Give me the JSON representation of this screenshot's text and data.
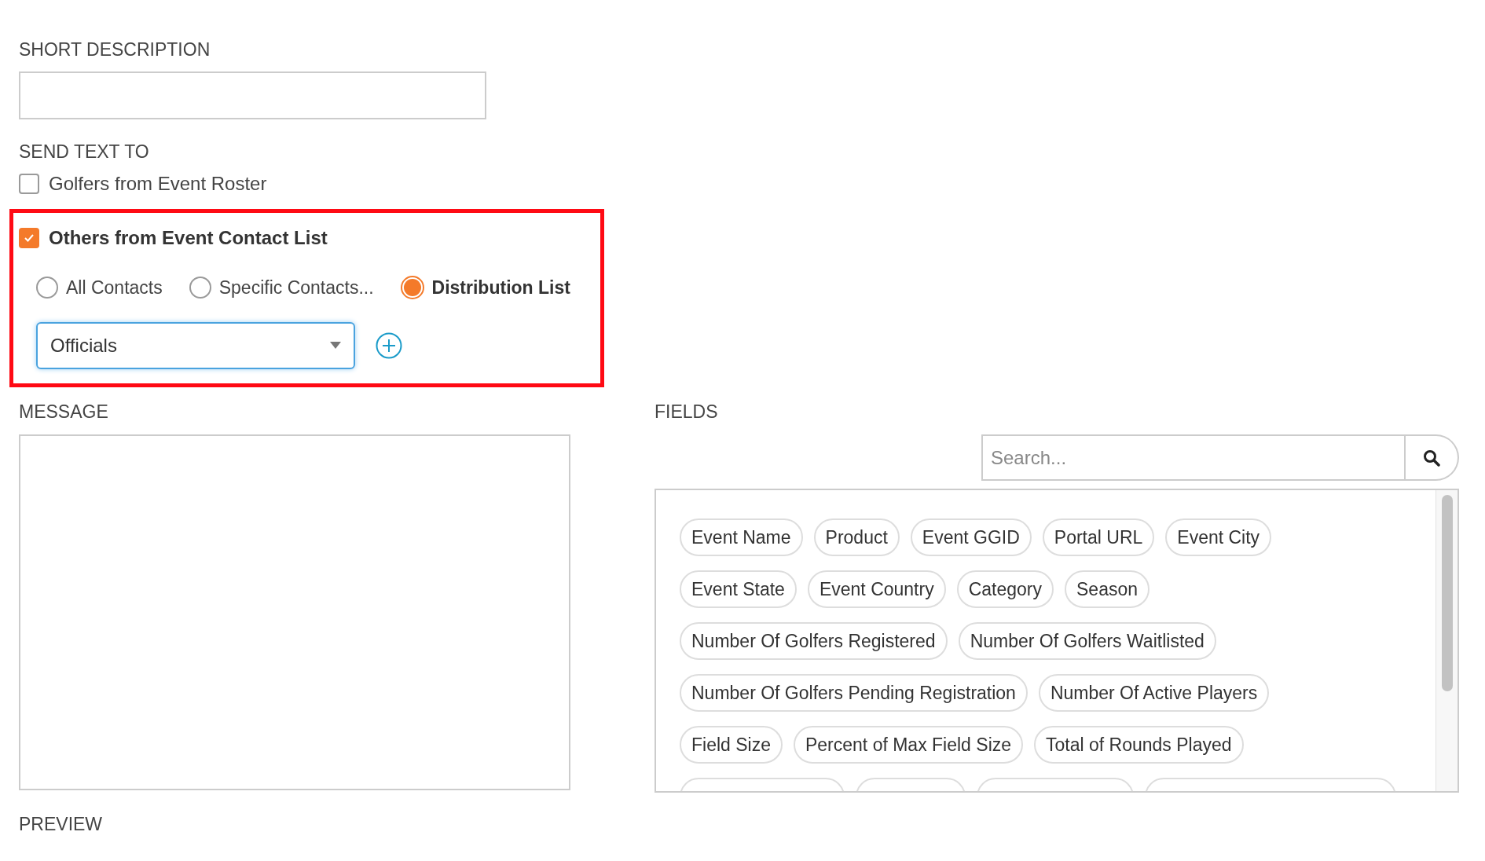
{
  "short_description": {
    "label": "SHORT DESCRIPTION"
  },
  "send_text_to": {
    "label": "SEND TEXT TO",
    "options": [
      {
        "label": "Golfers from Event Roster",
        "checked": false,
        "highlighted": false
      },
      {
        "label": "Others from Event Contact List",
        "checked": true,
        "highlighted": true
      }
    ],
    "contact_modes": [
      {
        "label": "All Contacts",
        "selected": false
      },
      {
        "label": "Specific Contacts...",
        "selected": false
      },
      {
        "label": "Distribution List",
        "selected": true
      }
    ],
    "distribution_list": {
      "value": "Officials"
    }
  },
  "message": {
    "label": "MESSAGE"
  },
  "fields": {
    "label": "FIELDS",
    "search_placeholder": "Search...",
    "tag_rows": [
      [
        "Event Name",
        "Product",
        "Event GGID",
        "Portal URL",
        "Event City"
      ],
      [
        "Event State",
        "Event Country",
        "Category",
        "Season"
      ],
      [
        "Number Of Golfers Registered",
        "Number Of Golfers Waitlisted"
      ],
      [
        "Number Of Golfers Pending Registration",
        "Number Of Active Players"
      ],
      [
        "Field Size",
        "Percent of Max Field Size",
        "Total of Rounds Played"
      ]
    ]
  },
  "preview": {
    "label": "PREVIEW"
  }
}
